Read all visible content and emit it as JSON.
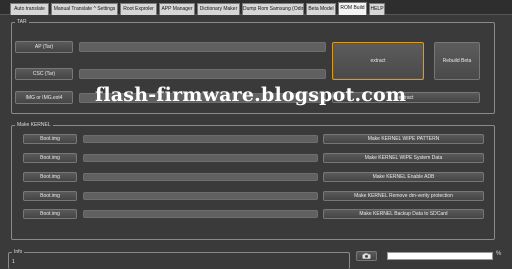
{
  "tabs": [
    {
      "label": "Auto translate",
      "active": false
    },
    {
      "label": "Manual Translate ^ Settings",
      "active": false
    },
    {
      "label": "Root Exproler",
      "active": false
    },
    {
      "label": "APP Manager",
      "active": false
    },
    {
      "label": "Dictionary Maker",
      "active": false
    },
    {
      "label": "Dump Rom Samsung (Odin)",
      "active": false
    },
    {
      "label": "Beta Model",
      "active": false
    },
    {
      "label": "ROM Build",
      "active": true
    },
    {
      "label": "HELP",
      "active": false
    }
  ],
  "tar_group": {
    "legend": "TAR",
    "ap_button": "AP (Tar)",
    "csc_button": "CSC (Tar)",
    "img_button": "IMG or IMG.ext4",
    "extract_button": "extract",
    "rebuild_button": "Rebuild Beta",
    "extract_img_button": "extract"
  },
  "kernel_group": {
    "legend": "Make KERNEL",
    "rows": [
      {
        "boot_label": "Boot.img",
        "action_label": "Make KERNEL WIPE PATTERN"
      },
      {
        "boot_label": "Boot.img",
        "action_label": "Make KERNEL WIPE System Data"
      },
      {
        "boot_label": "Boot.img",
        "action_label": "Make KERNEL  Enable ADB"
      },
      {
        "boot_label": "Boot.img",
        "action_label": "Make KERNEL  Remove dm-verity protection"
      },
      {
        "boot_label": "Boot.img",
        "action_label": "Make KERNEL  Backup Data to SDCard"
      }
    ]
  },
  "info_group": {
    "legend": "Info",
    "text": "1"
  },
  "progress": {
    "fraction": 0.0,
    "percent_label": "%"
  },
  "watermark": "flash-firmware.blogspot.com",
  "colors": {
    "background": "#3a3a3a",
    "button": "#4d4d4d",
    "focus_border": "#d99a2a",
    "field": "#606060"
  },
  "icons": {
    "camera": "camera-icon"
  }
}
